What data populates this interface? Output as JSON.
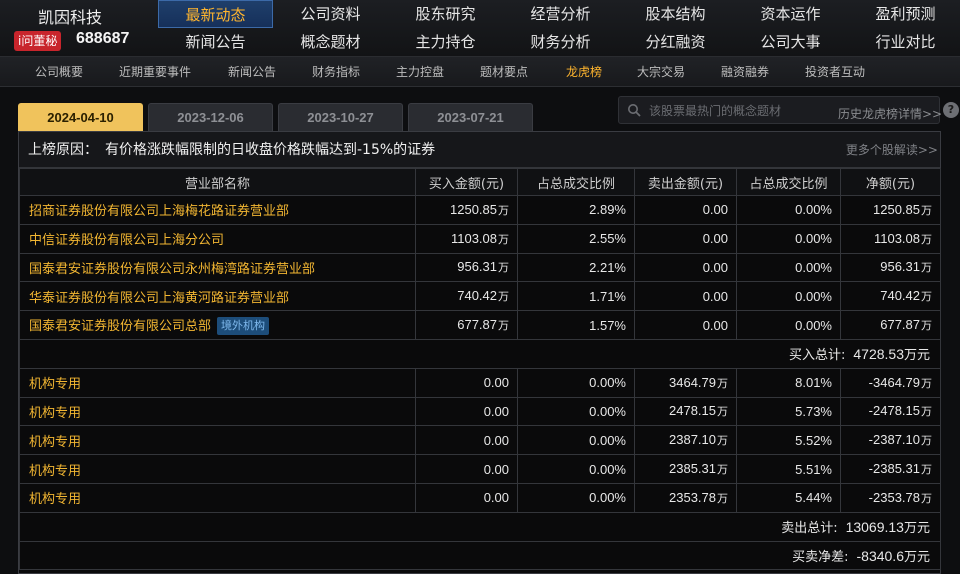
{
  "company": {
    "name": "凯因科技",
    "badge": "i问董秘",
    "code": "688687"
  },
  "main_nav": {
    "row1": [
      "最新动态",
      "公司资料",
      "股东研究",
      "经营分析",
      "股本结构",
      "资本运作",
      "盈利预测"
    ],
    "row2": [
      "新闻公告",
      "概念题材",
      "主力持仓",
      "财务分析",
      "分红融资",
      "公司大事",
      "行业对比"
    ]
  },
  "sub_nav": [
    "公司概要",
    "近期重要事件",
    "新闻公告",
    "财务指标",
    "主力控盘",
    "题材要点",
    "龙虎榜",
    "大宗交易",
    "融资融券",
    "投资者互动"
  ],
  "date_tabs": [
    "2024-04-10",
    "2023-12-06",
    "2023-10-27",
    "2023-07-21"
  ],
  "search": {
    "placeholder": "该股票最热门的概念题材"
  },
  "history_link": "历史龙虎榜详情>>",
  "reason": {
    "label": "上榜原因：",
    "text": "有价格涨跌幅限制的日收盘价格跌幅达到-15%的证券",
    "more_link": "更多个股解读>>"
  },
  "table": {
    "headers": [
      "营业部名称",
      "买入金额(元)",
      "占总成交比例",
      "卖出金额(元)",
      "占总成交比例",
      "净额(元)"
    ],
    "unit": "万",
    "buy_rows": [
      {
        "name": "招商证券股份有限公司上海梅花路证券营业部",
        "tag": "",
        "buy": "1250.85",
        "buy_unit": "万",
        "buy_pct": "2.89%",
        "sell": "0.00",
        "sell_unit": "",
        "sell_pct": "0.00%",
        "net": "1250.85",
        "net_unit": "万"
      },
      {
        "name": "中信证券股份有限公司上海分公司",
        "tag": "",
        "buy": "1103.08",
        "buy_unit": "万",
        "buy_pct": "2.55%",
        "sell": "0.00",
        "sell_unit": "",
        "sell_pct": "0.00%",
        "net": "1103.08",
        "net_unit": "万"
      },
      {
        "name": "国泰君安证券股份有限公司永州梅湾路证券营业部",
        "tag": "",
        "buy": "956.31",
        "buy_unit": "万",
        "buy_pct": "2.21%",
        "sell": "0.00",
        "sell_unit": "",
        "sell_pct": "0.00%",
        "net": "956.31",
        "net_unit": "万"
      },
      {
        "name": "华泰证券股份有限公司上海黄河路证券营业部",
        "tag": "",
        "buy": "740.42",
        "buy_unit": "万",
        "buy_pct": "1.71%",
        "sell": "0.00",
        "sell_unit": "",
        "sell_pct": "0.00%",
        "net": "740.42",
        "net_unit": "万"
      },
      {
        "name": "国泰君安证券股份有限公司总部",
        "tag": "境外机构",
        "buy": "677.87",
        "buy_unit": "万",
        "buy_pct": "1.57%",
        "sell": "0.00",
        "sell_unit": "",
        "sell_pct": "0.00%",
        "net": "677.87",
        "net_unit": "万"
      }
    ],
    "buy_total": {
      "label": "买入总计:",
      "value": "4728.53",
      "unit": "万元"
    },
    "sell_rows": [
      {
        "name": "机构专用",
        "tag": "",
        "buy": "0.00",
        "buy_unit": "",
        "buy_pct": "0.00%",
        "sell": "3464.79",
        "sell_unit": "万",
        "sell_pct": "8.01%",
        "net": "-3464.79",
        "net_unit": "万"
      },
      {
        "name": "机构专用",
        "tag": "",
        "buy": "0.00",
        "buy_unit": "",
        "buy_pct": "0.00%",
        "sell": "2478.15",
        "sell_unit": "万",
        "sell_pct": "5.73%",
        "net": "-2478.15",
        "net_unit": "万"
      },
      {
        "name": "机构专用",
        "tag": "",
        "buy": "0.00",
        "buy_unit": "",
        "buy_pct": "0.00%",
        "sell": "2387.10",
        "sell_unit": "万",
        "sell_pct": "5.52%",
        "net": "-2387.10",
        "net_unit": "万"
      },
      {
        "name": "机构专用",
        "tag": "",
        "buy": "0.00",
        "buy_unit": "",
        "buy_pct": "0.00%",
        "sell": "2385.31",
        "sell_unit": "万",
        "sell_pct": "5.51%",
        "net": "-2385.31",
        "net_unit": "万"
      },
      {
        "name": "机构专用",
        "tag": "",
        "buy": "0.00",
        "buy_unit": "",
        "buy_pct": "0.00%",
        "sell": "2353.78",
        "sell_unit": "万",
        "sell_pct": "5.44%",
        "net": "-2353.78",
        "net_unit": "万"
      }
    ],
    "sell_total": {
      "label": "卖出总计:",
      "value": "13069.13",
      "unit": "万元"
    },
    "net_total": {
      "label": "买卖净差:",
      "value": "-8340.6",
      "unit": "万元"
    }
  },
  "colors": {
    "accent": "#ffb52e",
    "name_text": "#f2b632",
    "active_tab": "#f0c35c",
    "badge_red": "#c8252c",
    "tag_blue": "#1d4d7a"
  },
  "icons": [
    "search-icon",
    "help-icon"
  ]
}
